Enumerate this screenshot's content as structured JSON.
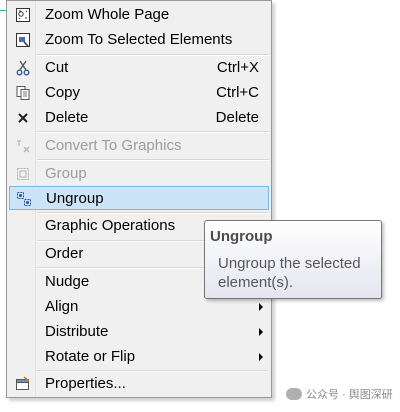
{
  "menu": {
    "items": [
      {
        "label": "Zoom Whole Page",
        "shortcut": "",
        "icon": "zoom-whole-page-icon",
        "disabled": false
      },
      {
        "label": "Zoom To Selected Elements",
        "shortcut": "",
        "icon": "zoom-selected-icon",
        "disabled": false
      },
      {
        "label": "Cut",
        "shortcut": "Ctrl+X",
        "icon": "scissors-icon",
        "disabled": false
      },
      {
        "label": "Copy",
        "shortcut": "Ctrl+C",
        "icon": "copy-icon",
        "disabled": false
      },
      {
        "label": "Delete",
        "shortcut": "Delete",
        "icon": "delete-x-icon",
        "disabled": false
      },
      {
        "label": "Convert To Graphics",
        "shortcut": "",
        "icon": "convert-graphics-icon",
        "disabled": true
      },
      {
        "label": "Group",
        "shortcut": "",
        "icon": "group-icon",
        "disabled": true
      },
      {
        "label": "Ungroup",
        "shortcut": "",
        "icon": "ungroup-icon",
        "disabled": false,
        "highlighted": true
      },
      {
        "label": "Graphic Operations",
        "shortcut": "",
        "icon": "",
        "disabled": false,
        "submenu": true
      },
      {
        "label": "Order",
        "shortcut": "",
        "icon": "",
        "disabled": false,
        "submenu": true
      },
      {
        "label": "Nudge",
        "shortcut": "",
        "icon": "",
        "disabled": false,
        "submenu": true
      },
      {
        "label": "Align",
        "shortcut": "",
        "icon": "",
        "disabled": false,
        "submenu": true
      },
      {
        "label": "Distribute",
        "shortcut": "",
        "icon": "",
        "disabled": false,
        "submenu": true
      },
      {
        "label": "Rotate or Flip",
        "shortcut": "",
        "icon": "",
        "disabled": false,
        "submenu": true
      },
      {
        "label": "Properties...",
        "shortcut": "",
        "icon": "properties-icon",
        "disabled": false
      }
    ]
  },
  "tooltip": {
    "title": "Ungroup",
    "body": "Ungroup the selected element(s)."
  },
  "watermark": {
    "text": "公众号 · 舆图深研"
  },
  "colors": {
    "menu_bg": "#f0f0f0",
    "highlight_bg": "#cce4f7",
    "highlight_border": "#7ab7e6",
    "disabled_text": "#9d9d9d"
  }
}
